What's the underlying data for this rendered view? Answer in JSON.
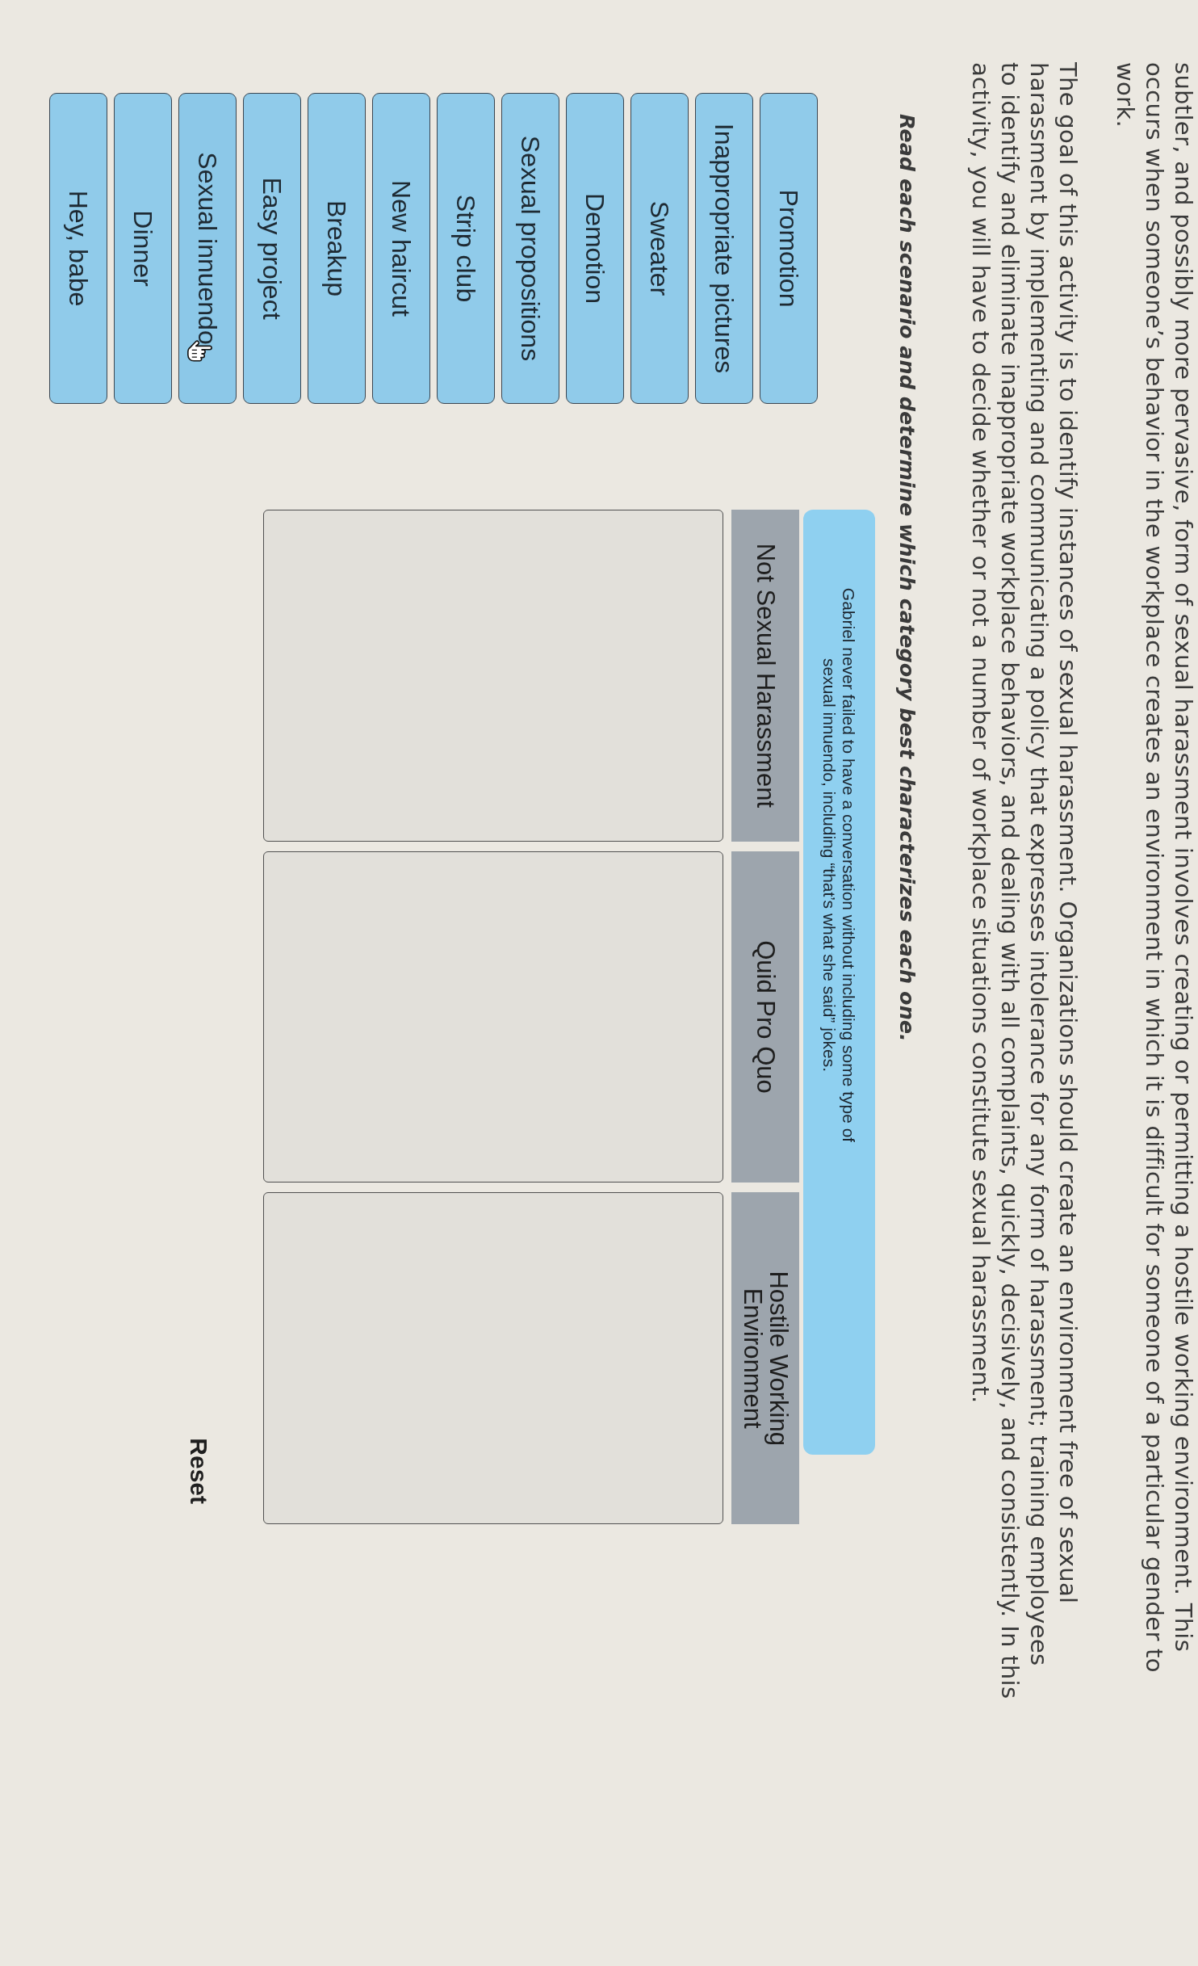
{
  "intro": {
    "paragraphs": [
      {
        "lines": [
          "subtler, and possibly more pervasive, form of sexual harassment involves creating or permitting a hostile working environment. This",
          "occurs when someone’s behavior in the workplace creates an environment in which it is difficult for someone of a particular gender to",
          "work."
        ]
      },
      {
        "lines": [
          "The goal of this activity is to identify instances of sexual harassment. Organizations should create an environment free of sexual",
          "harassment by implementing and communicating a policy that expresses intolerance for any form of harassment; training employees",
          "to identify and eliminate inappropriate workplace behaviors, and dealing with all complaints, quickly, decisively, and consistently. In this",
          "activity, you will have to decide whether or not a number of workplace situations constitute sexual harassment."
        ]
      }
    ],
    "instruction": "Read each scenario and determine which category best characterizes each one."
  },
  "answer_cards": [
    {
      "label": "Promotion",
      "hovered": false
    },
    {
      "label": "Inappropriate pictures",
      "hovered": false
    },
    {
      "label": "Sweater",
      "hovered": false
    },
    {
      "label": "Demotion",
      "hovered": false
    },
    {
      "label": "Sexual propositions",
      "hovered": false
    },
    {
      "label": "Strip club",
      "hovered": false
    },
    {
      "label": "New haircut",
      "hovered": false
    },
    {
      "label": "Breakup",
      "hovered": false
    },
    {
      "label": "Easy project",
      "hovered": false
    },
    {
      "label": "Sexual innuendo",
      "hovered": true
    },
    {
      "label": "Dinner",
      "hovered": false
    },
    {
      "label": "Hey, babe",
      "hovered": false
    }
  ],
  "scenario": {
    "text": "Gabriel never failed to have a conversation without including some type of sexual innuendo, including “that’s what she said” jokes."
  },
  "categories": [
    {
      "label": "Not Sexual Harassment"
    },
    {
      "label": "Quid Pro Quo"
    },
    {
      "label": "Hostile Working Environment"
    }
  ],
  "reset_button": {
    "label": "Reset"
  }
}
